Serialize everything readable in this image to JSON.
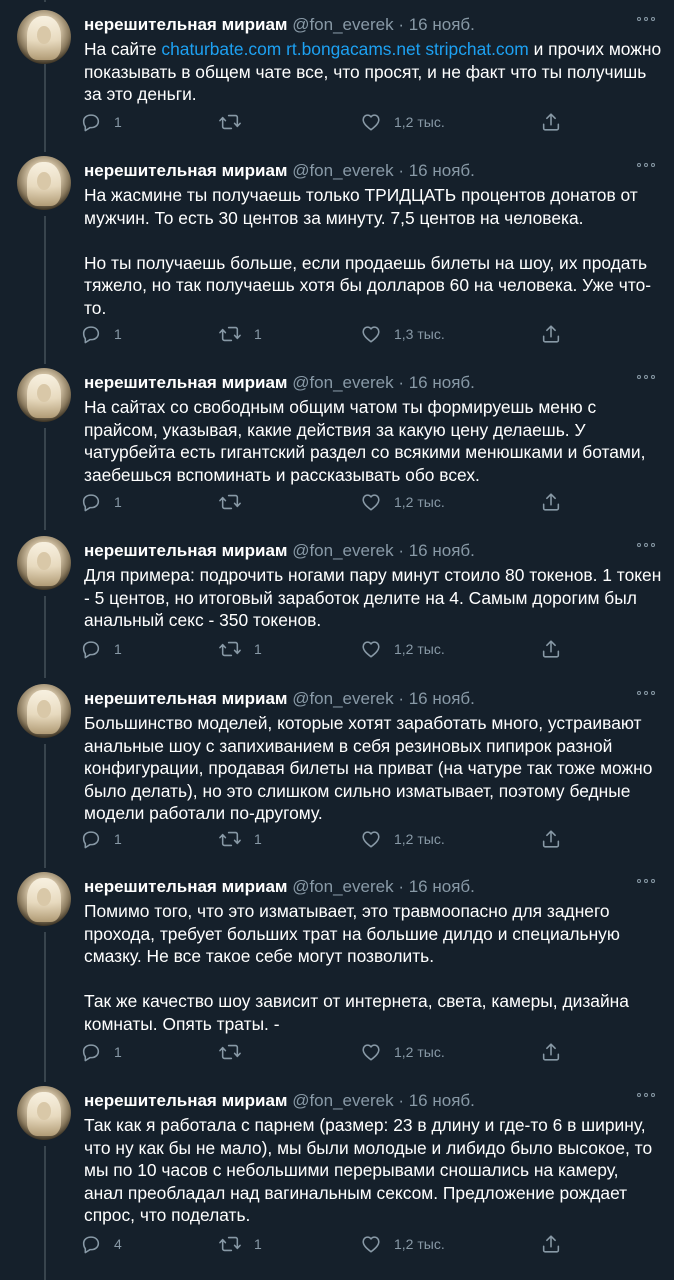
{
  "tweets": [
    {
      "name": "нерешительная мириам",
      "handle": "@fon_everek",
      "sep": "·",
      "date": "16 нояб.",
      "body_parts": [
        {
          "text": "На сайте ",
          "link": false
        },
        {
          "text": "chaturbate.com",
          "link": true
        },
        {
          "text": " ",
          "link": false
        },
        {
          "text": "rt.bongacams.net",
          "link": true
        },
        {
          "text": " ",
          "link": false
        },
        {
          "text": "stripchat.com",
          "link": true
        },
        {
          "text": " и прочих можно показывать в общем чате все, что просят, и не факт что ты получишь за это деньги.",
          "link": false
        }
      ],
      "replies": "1",
      "retweets": "",
      "likes": "1,2 тыс."
    },
    {
      "name": "нерешительная мириам",
      "handle": "@fon_everek",
      "sep": "·",
      "date": "16 нояб.",
      "paragraphs": [
        "На жасмине ты получаешь только ТРИДЦАТЬ процентов донатов от мужчин. То есть 30 центов за минуту. 7,5 центов на человека.",
        "Но ты получаешь больше, если продаешь билеты на шоу, их продать тяжело, но так получаешь хотя бы долларов 60 на человека. Уже что-то."
      ],
      "replies": "1",
      "retweets": "1",
      "likes": "1,3 тыс."
    },
    {
      "name": "нерешительная мириам",
      "handle": "@fon_everek",
      "sep": "·",
      "date": "16 нояб.",
      "paragraphs": [
        "На сайтах со свободным общим чатом ты формируешь меню с прайсом, указывая, какие действия за какую цену делаешь. У чатурбейта есть гигантский раздел со всякими менюшками и ботами, заебешься вспоминать и рассказывать обо всех."
      ],
      "replies": "1",
      "retweets": "",
      "likes": "1,2 тыс."
    },
    {
      "name": "нерешительная мириам",
      "handle": "@fon_everek",
      "sep": "·",
      "date": "16 нояб.",
      "paragraphs": [
        "Для примера: подрочить ногами пару минут стоило 80 токенов. 1 токен - 5 центов, но итоговый заработок делите на 4. Самым дорогим был анальный секс - 350 токенов."
      ],
      "replies": "1",
      "retweets": "1",
      "likes": "1,2 тыс."
    },
    {
      "name": "нерешительная мириам",
      "handle": "@fon_everek",
      "sep": "·",
      "date": "16 нояб.",
      "paragraphs": [
        "Большинство моделей, которые хотят заработать много, устраивают анальные шоу с запихиванием в себя резиновых пипирок разной конфигурации, продавая билеты на приват (на чатуре так тоже можно было делать), но это слишком сильно изматывает, поэтому бедные модели работали по-другому."
      ],
      "replies": "1",
      "retweets": "1",
      "likes": "1,2 тыс."
    },
    {
      "name": "нерешительная мириам",
      "handle": "@fon_everek",
      "sep": "·",
      "date": "16 нояб.",
      "paragraphs": [
        "Помимо того, что это изматывает, это травмоопасно для заднего прохода, требует больших трат на большие дилдо и специальную смазку. Не все такое себе могут позволить.",
        "Так же качество шоу зависит от интернета, света, камеры, дизайна комнаты. Опять траты. -"
      ],
      "replies": "1",
      "retweets": "",
      "likes": "1,2 тыс."
    },
    {
      "name": "нерешительная мириам",
      "handle": "@fon_everek",
      "sep": "·",
      "date": "16 нояб.",
      "paragraphs": [
        "Так как я работала с парнем (размер: 23 в длину и где-то 6 в ширину, что ну как бы не мало), мы были молодые и либидо было высокое, то мы по 10 часов с небольшими перерывами сношались на камеру, анал преобладал над вагинальным сексом. Предложение рождает спрос, что поделать."
      ],
      "replies": "4",
      "retweets": "1",
      "likes": "1,2 тыс."
    }
  ]
}
